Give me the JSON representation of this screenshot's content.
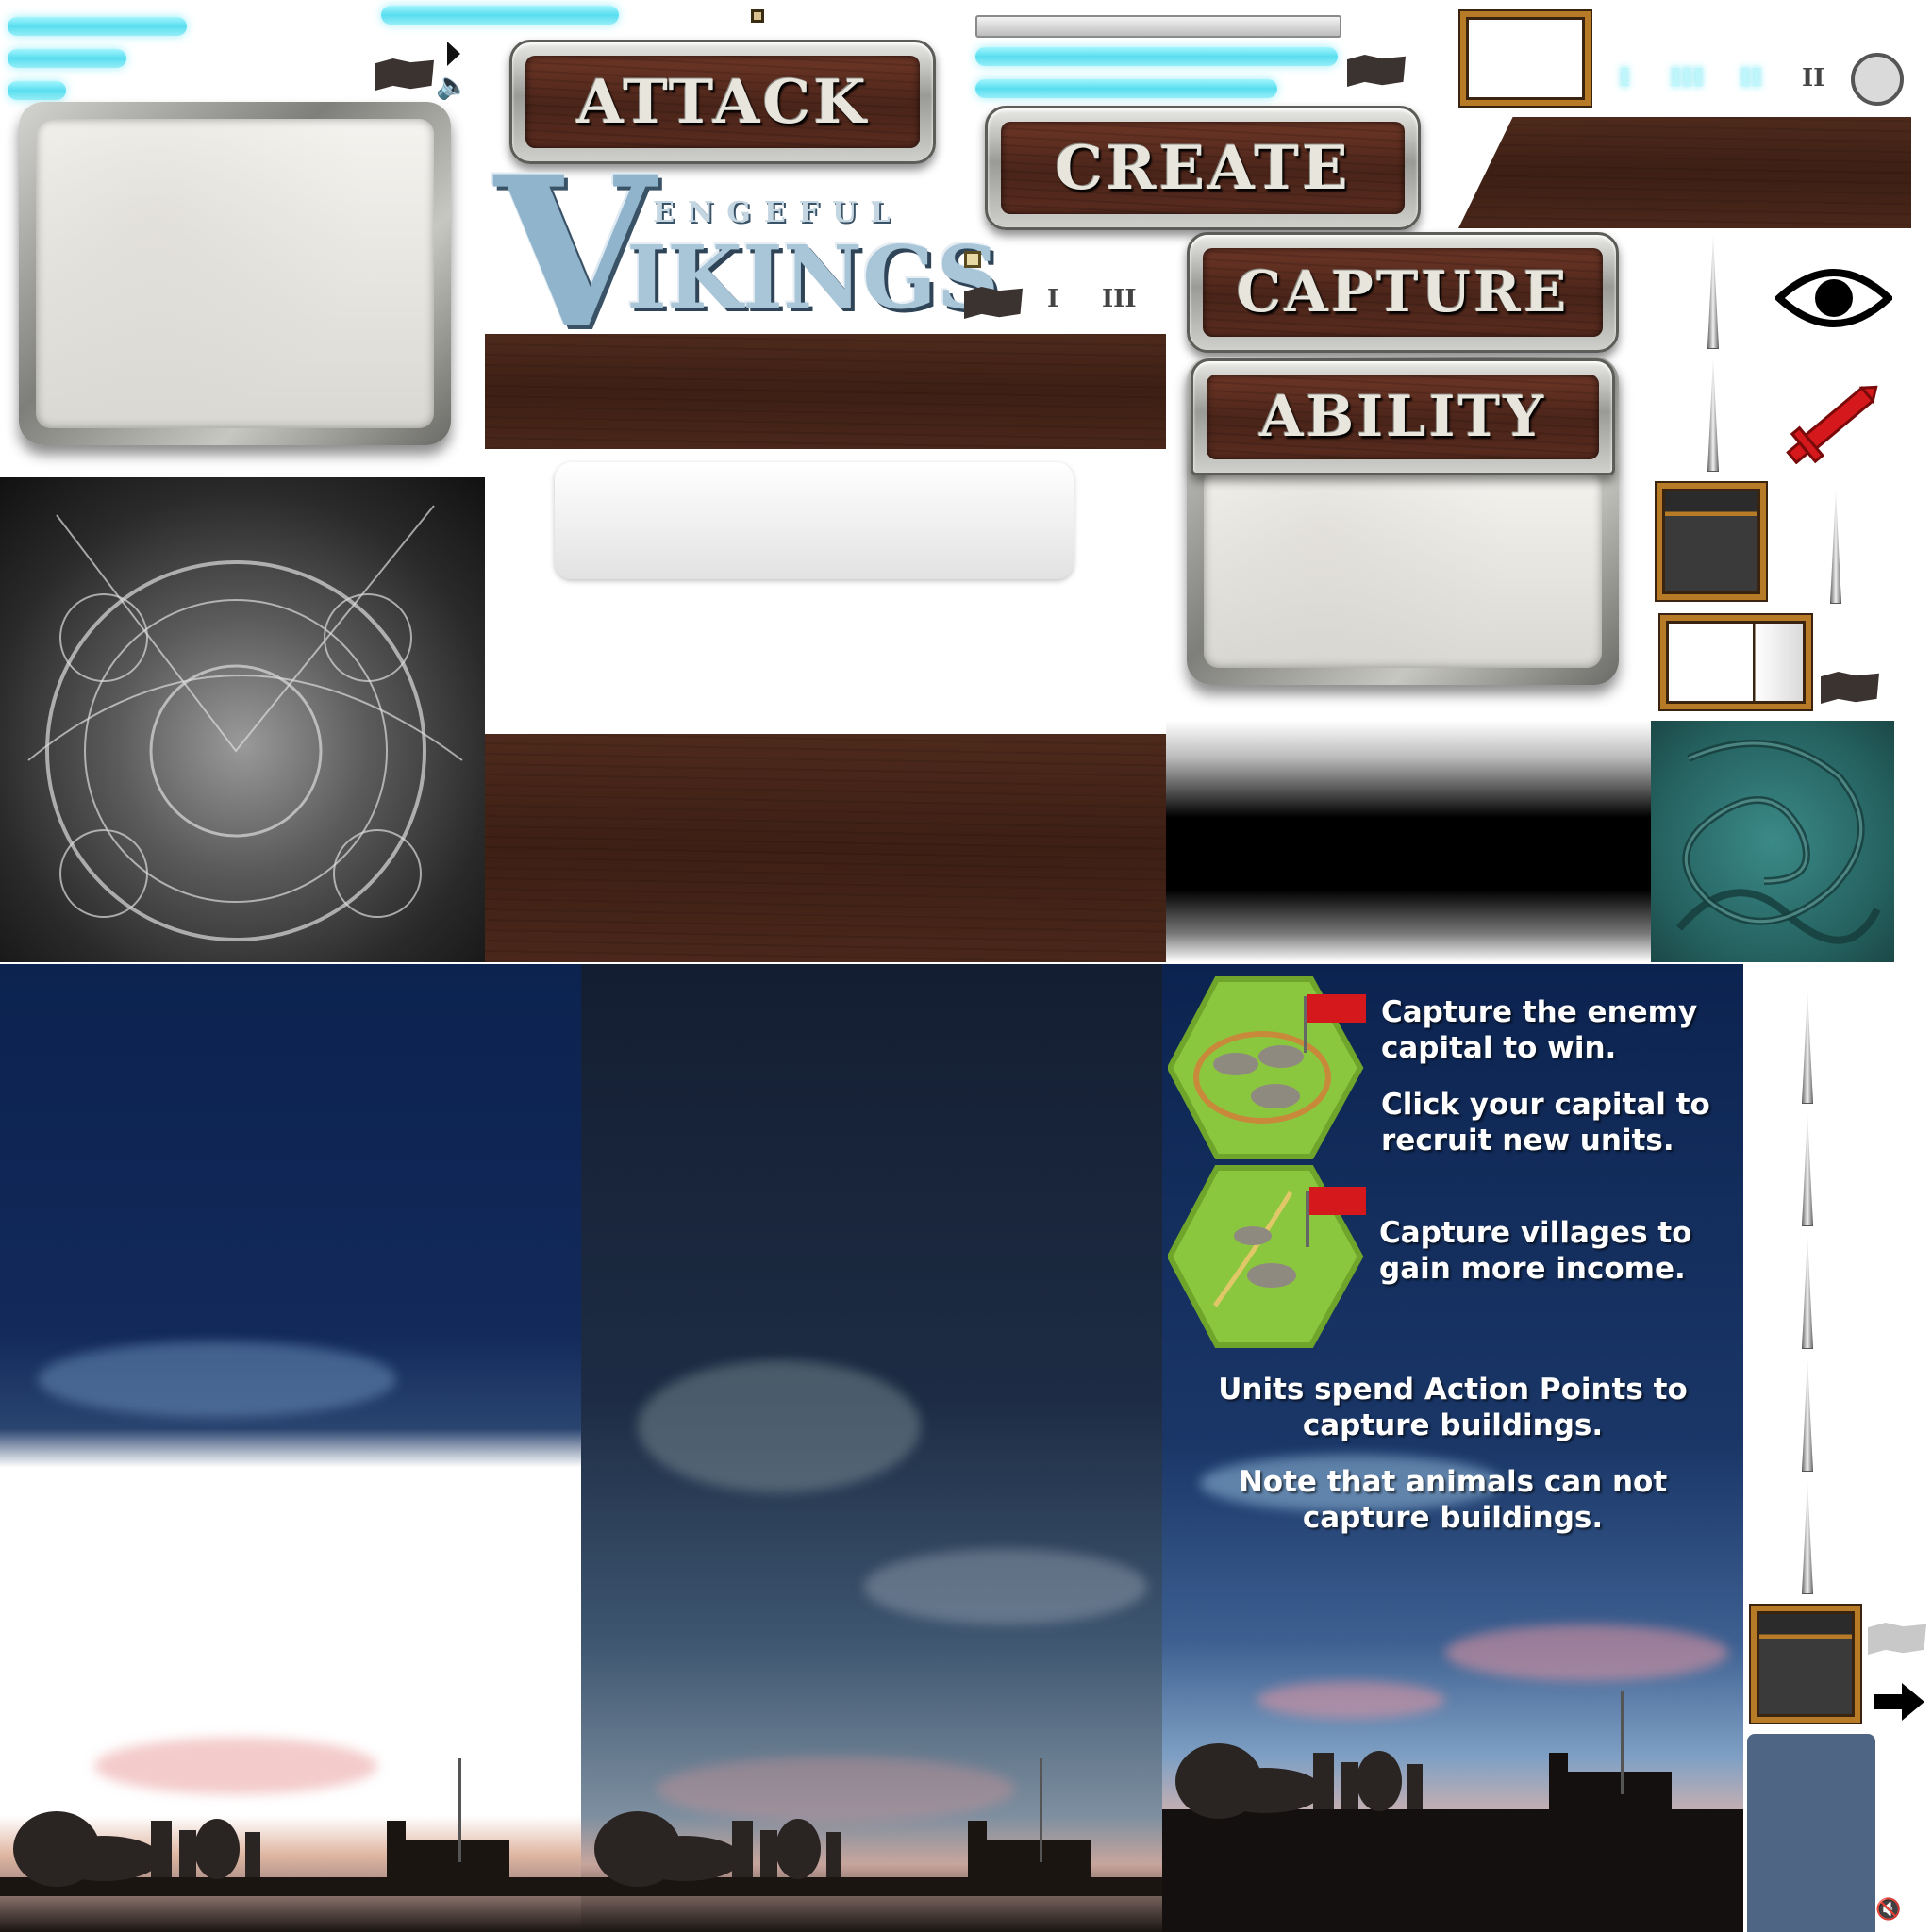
{
  "buttons": {
    "attack": "ATTACK",
    "create": "CREATE",
    "capture": "CAPTURE",
    "ability": "ABILITY"
  },
  "logo": {
    "line1": "ENGEFUL",
    "line2": "IKINGS",
    "initial": "V"
  },
  "roman": {
    "one": "I",
    "two": "II",
    "three": "III"
  },
  "tips": {
    "capital_1": "Capture the enemy capital to win.",
    "capital_2": "Click your capital to recruit new units.",
    "villages": "Capture villages to gain more income.",
    "action_points": "Units spend Action Points to capture buildings.",
    "animals": "Note that animals can not capture buildings."
  },
  "icons": [
    "play-icon",
    "speaker-icon",
    "checkbox-icon",
    "eye-icon",
    "sword-icon",
    "flag-icon",
    "arrow-right-icon",
    "mute-icon"
  ],
  "colors": {
    "cyan_bar": "#2fd6ec",
    "wood": "#4a2419",
    "gold_frame": "#b77a27",
    "hex_green": "#8bc63f",
    "red_flag": "#d4181b"
  }
}
